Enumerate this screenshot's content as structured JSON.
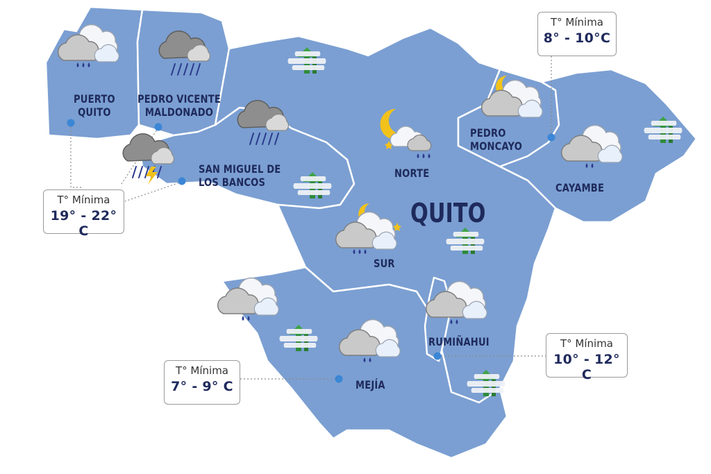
{
  "city": "QUITO",
  "zones": [
    {
      "id": "puerto-quito",
      "name": "PUERTO\nQUITO"
    },
    {
      "id": "pedro-vicente-maldonado",
      "name": "PEDRO VICENTE\nMALDONADO"
    },
    {
      "id": "san-miguel-de-los-bancos",
      "name": "SAN MIGUEL DE\nLOS BANCOS"
    },
    {
      "id": "norte",
      "name": "NORTE"
    },
    {
      "id": "pedro-moncayo",
      "name": "PEDRO\nMONCAYO"
    },
    {
      "id": "cayambe",
      "name": "CAYAMBE"
    },
    {
      "id": "sur",
      "name": "SUR"
    },
    {
      "id": "rumiñahui",
      "name": "RUMIÑAHUI"
    },
    {
      "id": "mejia",
      "name": "MEJÍA"
    }
  ],
  "temp_boxes": [
    {
      "title": "T° Mínima",
      "range": "8° - 10°C"
    },
    {
      "title": "T° Mínima",
      "range": "19° - 22° C"
    },
    {
      "title": "T° Mínima",
      "range": "10° - 12° C"
    },
    {
      "title": "T° Mínima",
      "range": "7° - 9° C"
    }
  ],
  "colors": {
    "region_fill": "#7b9fd2",
    "border": "#ffffff",
    "label": "#1f2a5c",
    "dot": "#3b86d6",
    "cloud_dark": "#a3a3a3",
    "cloud_light": "#dfe4ec",
    "sun": "#f2c21b",
    "rain": "#2b3a8c"
  },
  "icons": [
    {
      "name": "rain-cloud-icon"
    },
    {
      "name": "heavy-rain-cloud-icon"
    },
    {
      "name": "thunderstorm-icon"
    },
    {
      "name": "night-partly-cloudy-icon"
    },
    {
      "name": "cloudy-drizzle-icon"
    },
    {
      "name": "foggy-trees-icon"
    }
  ]
}
